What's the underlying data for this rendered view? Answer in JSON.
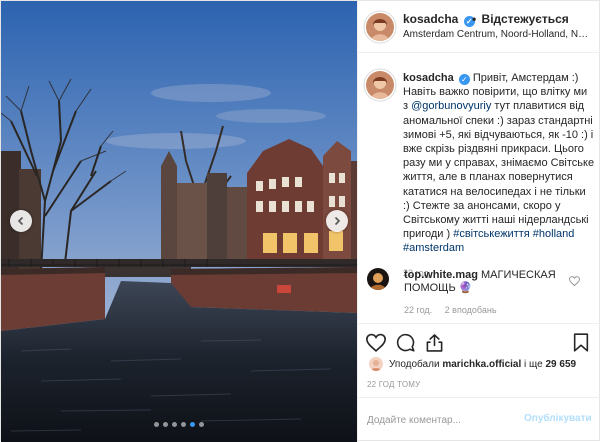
{
  "post": {
    "author": {
      "username": "kosadcha",
      "follow_label": "Відстежується",
      "location": "Amsterdam Centrum, Noord-Holland, Netherlands"
    },
    "caption": {
      "username": "kosadcha",
      "text_1": "Привіт, Амстердам :) Навіть важко повірити, що влітку ми з ",
      "mention": "@gorbunovyuriy",
      "text_2": " тут плавитися від аномальної спеки :) зараз стандартні зимові +5, які відчуваються, як -10 :) і вже скрізь різдвяні прикраси. Цього разу ми у справах, знімаємо Світське життя, але в планах повернутися кататися на велосипедах і не тільки :) Стежте за анонсами, скоро у Світському житті наші нідерландські пригоди ) ",
      "hashtags": "#світськежиття #holland #amsterdam",
      "time": "22 год."
    },
    "comment": {
      "username": "top.white.mag",
      "text": "МАГИЧЕСКАЯ ПОМОЩЬ",
      "emoji": "🔮",
      "time": "22 год.",
      "likes": "2 вподобань"
    },
    "likes": {
      "prefix": "Уподобали ",
      "user": "marichka.official",
      "middle": " і ще ",
      "count": "29 659"
    },
    "date": "22 ГОД ТОМУ",
    "comment_input": {
      "placeholder": "Додайте коментар..."
    },
    "publish_label": "Опублікувати",
    "carousel": {
      "total": 6,
      "active_index": 4
    },
    "colors": {
      "accent": "#3897f0",
      "link": "#003569",
      "muted": "#999999",
      "publish_disabled": "#b2dffc"
    },
    "icons": [
      "chevron-left-icon",
      "chevron-right-icon",
      "verified-icon",
      "heart-icon",
      "comment-icon",
      "share-icon",
      "bookmark-icon"
    ]
  }
}
